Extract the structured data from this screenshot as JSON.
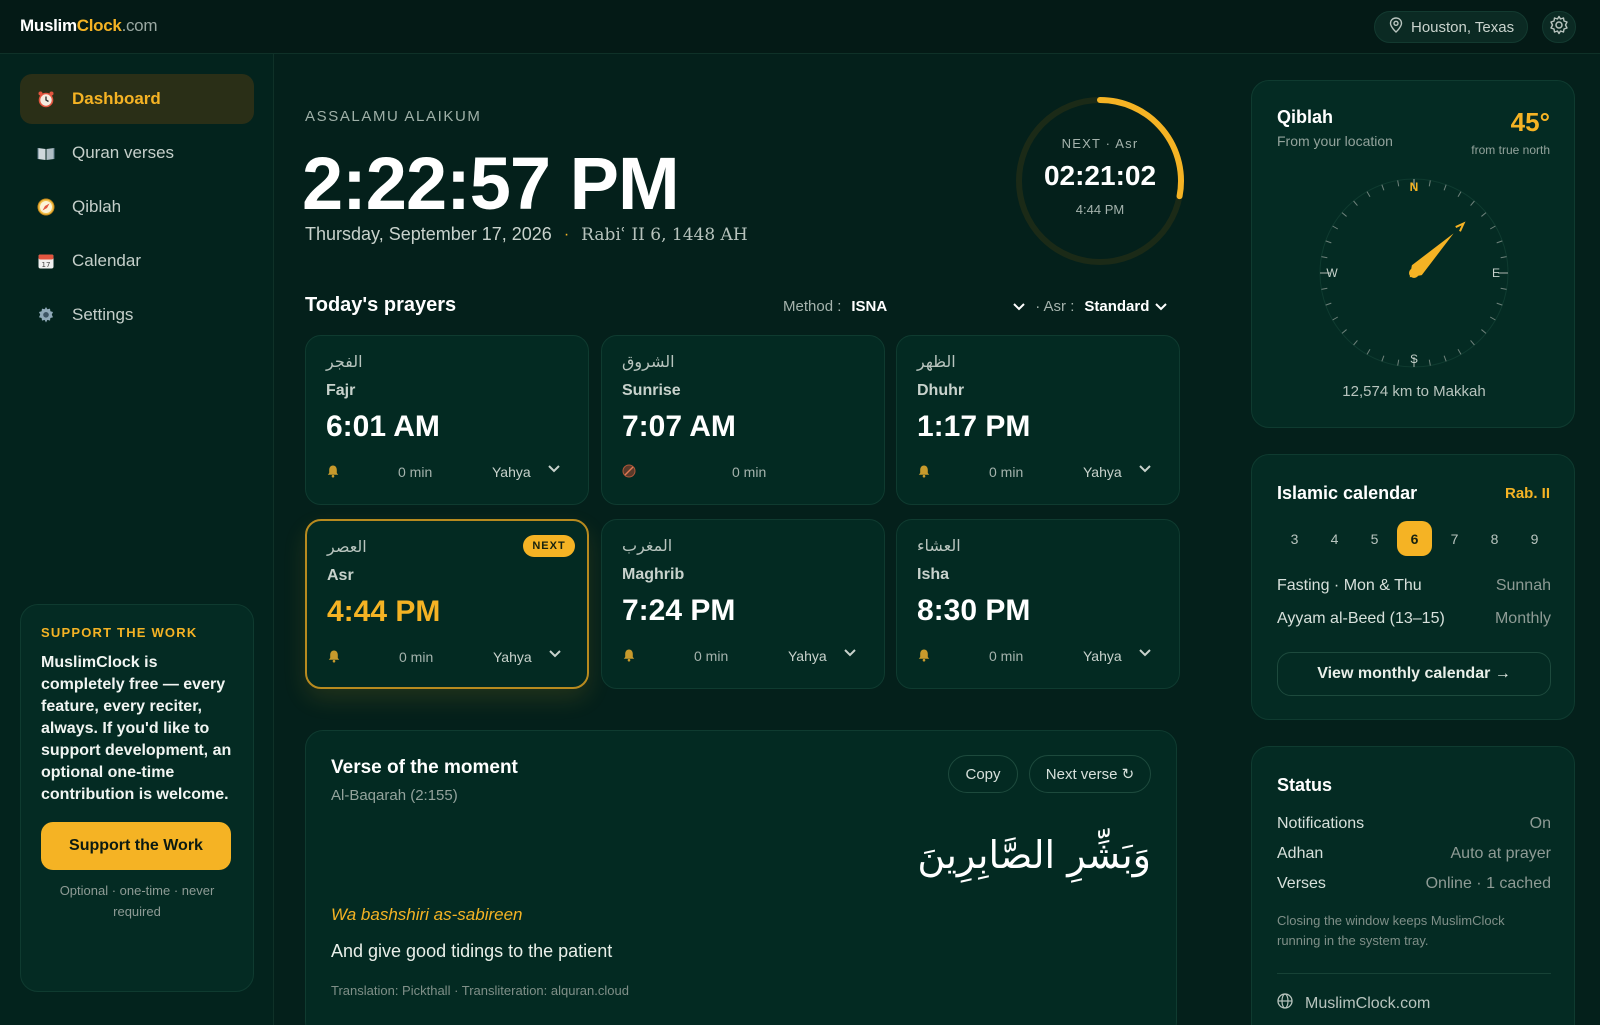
{
  "brand": {
    "part1": "Muslim",
    "part2": "Clock",
    "part3": ".com"
  },
  "location": {
    "label": "Houston, Texas",
    "icon": "map-pin-icon"
  },
  "colors": {
    "accent": "#f5b324",
    "background": "#04201b",
    "card": "#032a22"
  },
  "sidebar": {
    "items": [
      {
        "label": "Dashboard",
        "icon": "alarm-clock-icon",
        "active": true
      },
      {
        "label": "Quran verses",
        "icon": "book-icon",
        "active": false
      },
      {
        "label": "Qiblah",
        "icon": "compass-icon",
        "active": false
      },
      {
        "label": "Calendar",
        "icon": "calendar-icon",
        "active": false
      },
      {
        "label": "Settings",
        "icon": "gear-icon",
        "active": false
      }
    ],
    "support": {
      "title": "SUPPORT THE WORK",
      "text": "MuslimClock is completely free — every feature, every reciter, always. If you'd like to support development, an optional one-time contribution is welcome.",
      "button": "Support the Work",
      "note": "Optional · one-time · never required"
    }
  },
  "header": {
    "greeting": "ASSALAMU ALAIKUM",
    "time": "2:22:57 PM",
    "date": "Thursday, September 17, 2026",
    "separator": "·",
    "hijri": "Rabiʿ II 6, 1448 AH"
  },
  "countdown": {
    "label": "NEXT · Asr",
    "remaining": "02:21:02",
    "time": "4:44 PM",
    "progress": 0.28
  },
  "prayers": {
    "heading": "Today's prayers",
    "method_label": "Method :",
    "method_value": "ISNA",
    "asr_label": "· Asr :",
    "asr_value": "Standard",
    "next_badge": "NEXT",
    "list": [
      {
        "arabic": "الفجر",
        "name": "Fajr",
        "time": "6:01 AM",
        "offset": "0 min",
        "reciter": "Yahya",
        "muted": false,
        "next": false
      },
      {
        "arabic": "الشروق",
        "name": "Sunrise",
        "time": "7:07 AM",
        "offset": "0 min",
        "reciter": "",
        "muted": true,
        "next": false
      },
      {
        "arabic": "الظهر",
        "name": "Dhuhr",
        "time": "1:17 PM",
        "offset": "0 min",
        "reciter": "Yahya",
        "muted": false,
        "next": false
      },
      {
        "arabic": "العصر",
        "name": "Asr",
        "time": "4:44 PM",
        "offset": "0 min",
        "reciter": "Yahya",
        "muted": false,
        "next": true
      },
      {
        "arabic": "المغرب",
        "name": "Maghrib",
        "time": "7:24 PM",
        "offset": "0 min",
        "reciter": "Yahya",
        "muted": false,
        "next": false
      },
      {
        "arabic": "العشاء",
        "name": "Isha",
        "time": "8:30 PM",
        "offset": "0 min",
        "reciter": "Yahya",
        "muted": false,
        "next": false
      }
    ]
  },
  "verse": {
    "title": "Verse of the moment",
    "reference": "Al-Baqarah (2:155)",
    "copy_label": "Copy",
    "next_label": "Next verse ↻",
    "arabic": "وَبَشِّرِ الصَّابِرِينَ",
    "transliteration": "Wa bashshiri as-sabireen",
    "translation": "And give good tidings to the patient",
    "credit": "Translation: Pickthall · Transliteration: alquran.cloud"
  },
  "qiblah": {
    "title": "Qiblah",
    "subtitle": "From your location",
    "degrees": "45°",
    "degrees_note": "from true north",
    "bearing": 45,
    "directions": {
      "n": "N",
      "e": "E",
      "s": "S",
      "w": "W"
    },
    "distance": "12,574 km to Makkah"
  },
  "calendar": {
    "title": "Islamic calendar",
    "month": "Rab. II",
    "days": [
      "3",
      "4",
      "5",
      "6",
      "7",
      "8",
      "9"
    ],
    "selected": "6",
    "rows": [
      {
        "label": "Fasting · Mon & Thu",
        "value": "Sunnah"
      },
      {
        "label": "Ayyam al-Beed (13–15)",
        "value": "Monthly"
      }
    ],
    "button": "View monthly calendar →"
  },
  "status": {
    "title": "Status",
    "rows": [
      {
        "label": "Notifications",
        "value": "On"
      },
      {
        "label": "Adhan",
        "value": "Auto at prayer"
      },
      {
        "label": "Verses",
        "value": "Online · 1 cached"
      }
    ],
    "note": "Closing the window keeps MuslimClock running in the system tray.",
    "footer": "MuslimClock.com"
  }
}
